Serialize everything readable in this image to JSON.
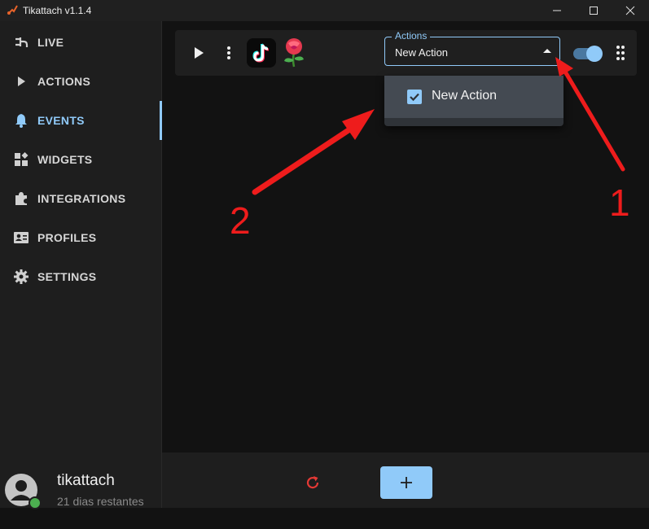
{
  "window": {
    "title": "Tikattach v1.1.4",
    "controls": [
      "minimize-icon",
      "maximize-icon",
      "close-icon"
    ]
  },
  "sidebar": {
    "items": [
      {
        "label": "LIVE",
        "icon": "plug-icon",
        "active": false
      },
      {
        "label": "ACTIONS",
        "icon": "play-icon",
        "active": false
      },
      {
        "label": "EVENTS",
        "icon": "bell-icon",
        "active": true
      },
      {
        "label": "WIDGETS",
        "icon": "widgets-icon",
        "active": false
      },
      {
        "label": "INTEGRATIONS",
        "icon": "puzzle-icon",
        "active": false
      },
      {
        "label": "PROFILES",
        "icon": "id-card-icon",
        "active": false
      },
      {
        "label": "SETTINGS",
        "icon": "gear-icon",
        "active": false
      }
    ],
    "user": {
      "name": "tikattach",
      "subtitle": "21 dias restantes",
      "status": "online"
    }
  },
  "event_card": {
    "actions_select": {
      "label": "Actions",
      "value": "New Action"
    },
    "dropdown_options": [
      {
        "label": "New Action",
        "checked": true
      }
    ],
    "toggle_on": true
  },
  "annotations": [
    {
      "label": "1"
    },
    {
      "label": "2"
    }
  ],
  "colors": {
    "accent": "#90caf9",
    "background": "#121212",
    "sidebar": "#1e1e1e",
    "annotation_red": "#ee1c1c",
    "refresh_red": "#e53935"
  }
}
